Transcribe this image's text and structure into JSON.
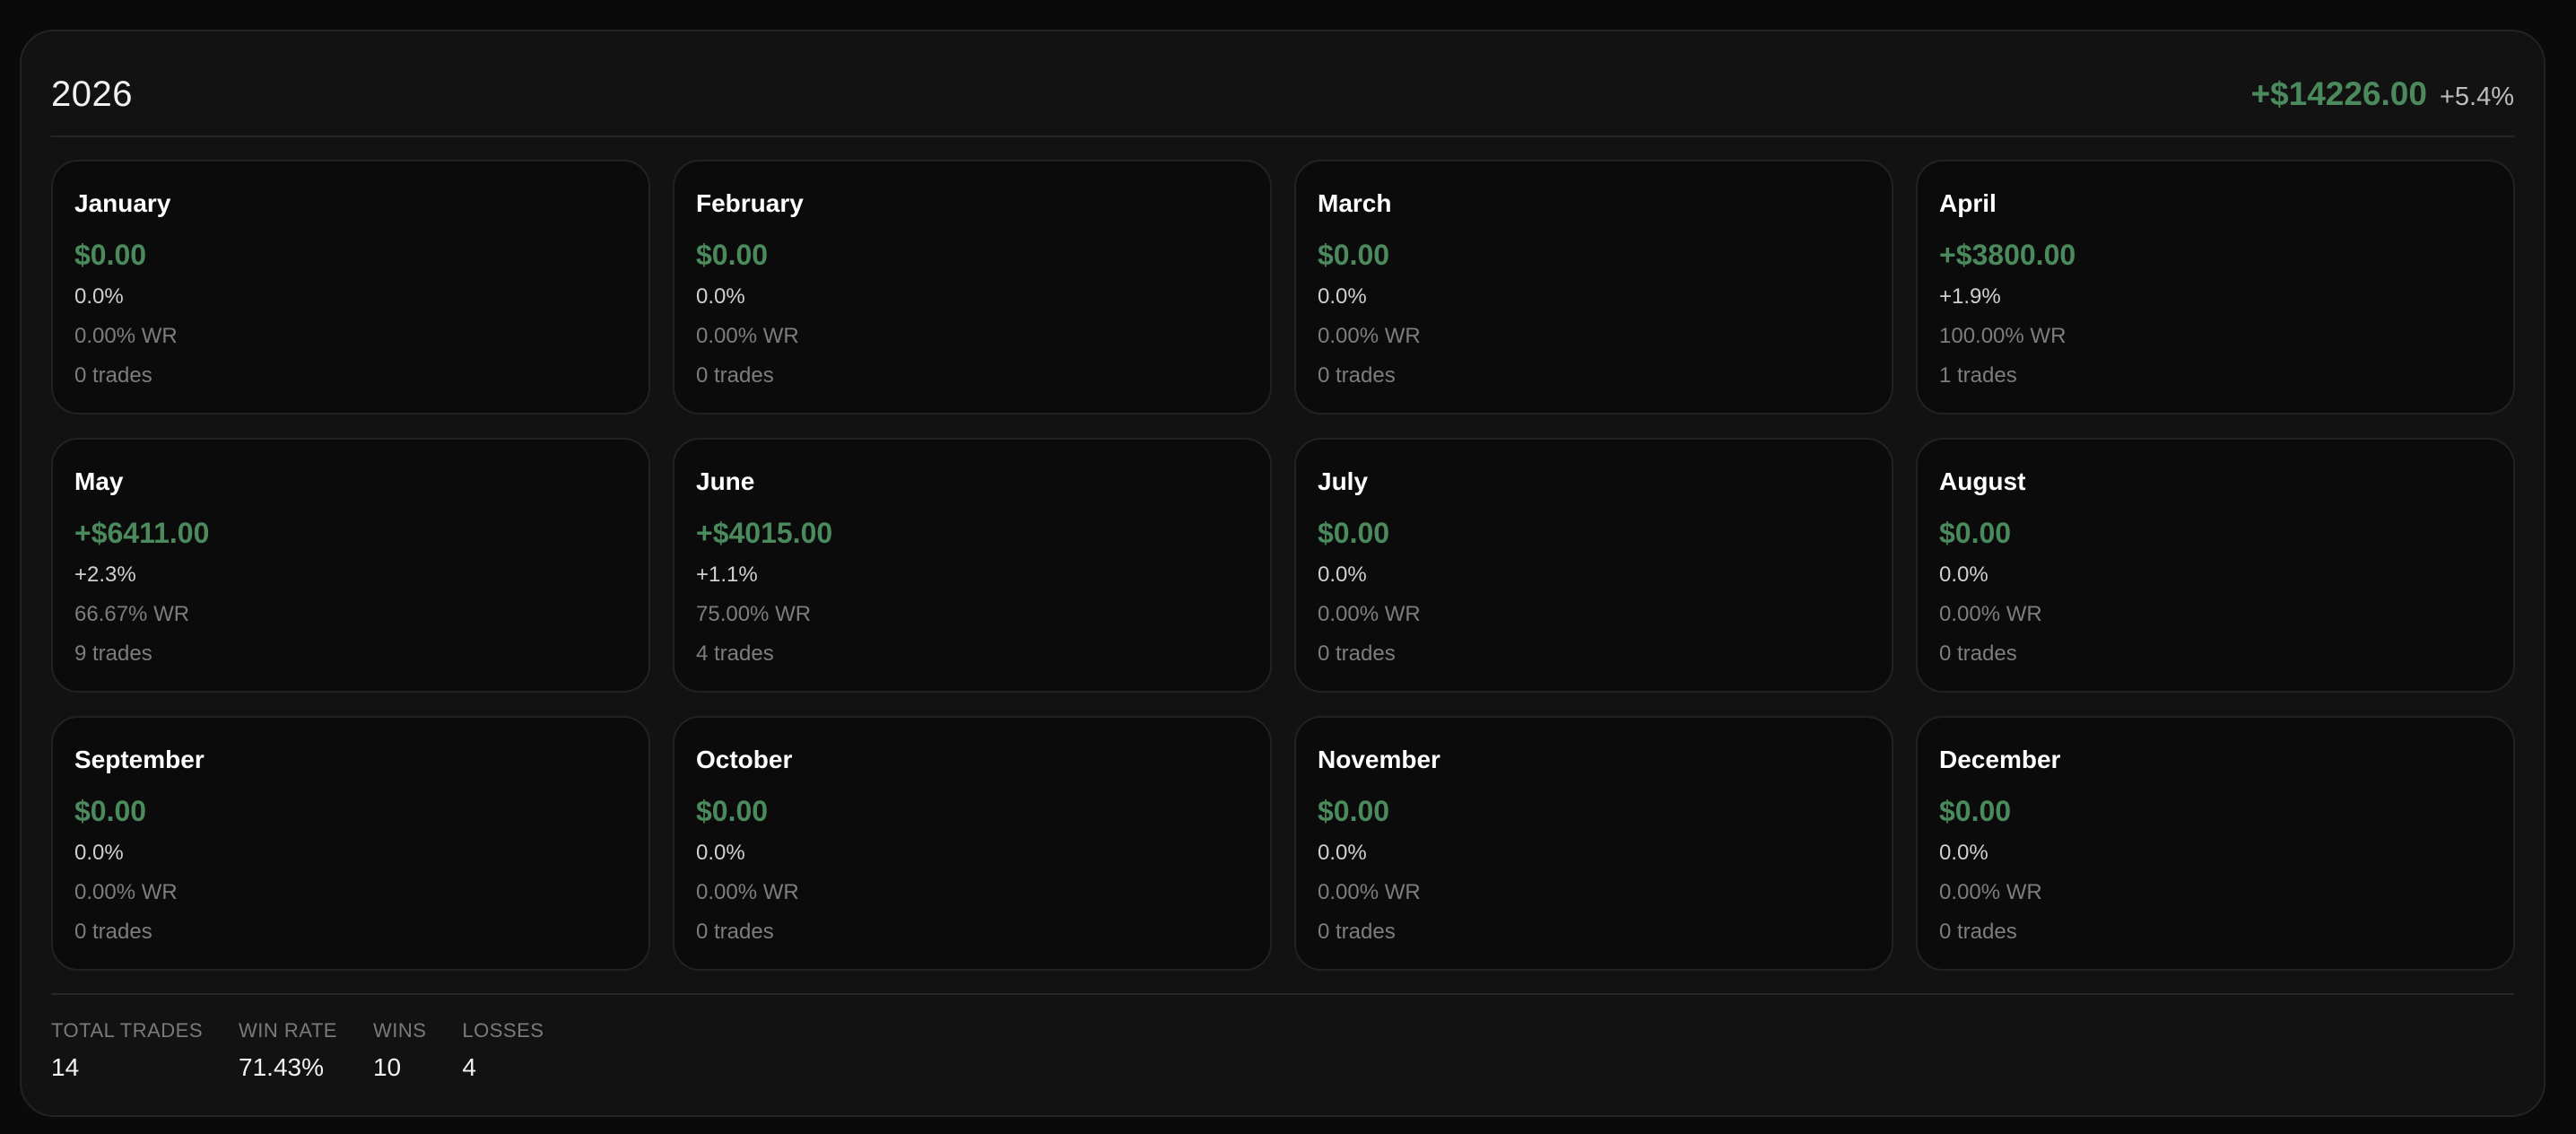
{
  "colors": {
    "positive": "#4a8a5c",
    "neutral_pct": "#cfcfcf",
    "muted": "#7d7d7d",
    "background": "#0a0a0a",
    "panel": "#121212"
  },
  "header": {
    "year": "2026",
    "total_pnl": "+$14226.00",
    "total_pct": "+5.4%"
  },
  "months": [
    {
      "name": "January",
      "pnl": "$0.00",
      "pct": "0.0%",
      "wr": "0.00% WR",
      "trades": "0 trades"
    },
    {
      "name": "February",
      "pnl": "$0.00",
      "pct": "0.0%",
      "wr": "0.00% WR",
      "trades": "0 trades"
    },
    {
      "name": "March",
      "pnl": "$0.00",
      "pct": "0.0%",
      "wr": "0.00% WR",
      "trades": "0 trades"
    },
    {
      "name": "April",
      "pnl": "+$3800.00",
      "pct": "+1.9%",
      "wr": "100.00% WR",
      "trades": "1 trades"
    },
    {
      "name": "May",
      "pnl": "+$6411.00",
      "pct": "+2.3%",
      "wr": "66.67% WR",
      "trades": "9 trades"
    },
    {
      "name": "June",
      "pnl": "+$4015.00",
      "pct": "+1.1%",
      "wr": "75.00% WR",
      "trades": "4 trades"
    },
    {
      "name": "July",
      "pnl": "$0.00",
      "pct": "0.0%",
      "wr": "0.00% WR",
      "trades": "0 trades"
    },
    {
      "name": "August",
      "pnl": "$0.00",
      "pct": "0.0%",
      "wr": "0.00% WR",
      "trades": "0 trades"
    },
    {
      "name": "September",
      "pnl": "$0.00",
      "pct": "0.0%",
      "wr": "0.00% WR",
      "trades": "0 trades"
    },
    {
      "name": "October",
      "pnl": "$0.00",
      "pct": "0.0%",
      "wr": "0.00% WR",
      "trades": "0 trades"
    },
    {
      "name": "November",
      "pnl": "$0.00",
      "pct": "0.0%",
      "wr": "0.00% WR",
      "trades": "0 trades"
    },
    {
      "name": "December",
      "pnl": "$0.00",
      "pct": "0.0%",
      "wr": "0.00% WR",
      "trades": "0 trades"
    }
  ],
  "stats": [
    {
      "label": "TOTAL TRADES",
      "value": "14"
    },
    {
      "label": "WIN RATE",
      "value": "71.43%"
    },
    {
      "label": "WINS",
      "value": "10"
    },
    {
      "label": "LOSSES",
      "value": "4"
    }
  ]
}
